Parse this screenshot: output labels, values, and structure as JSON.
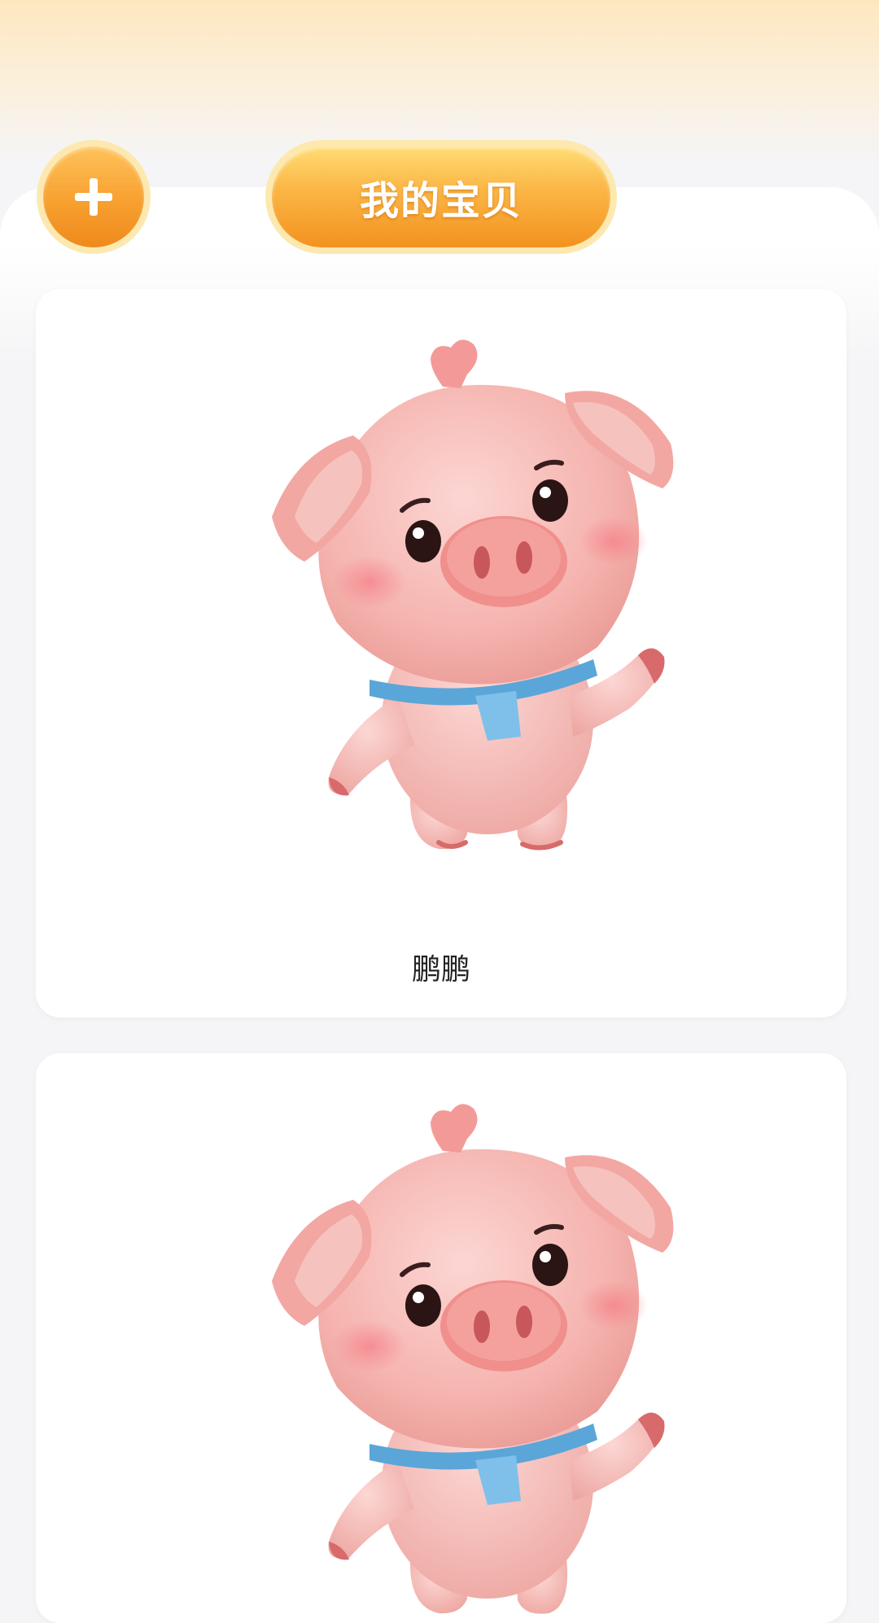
{
  "header": {
    "add_button_symbol": "+",
    "title": "我的宝贝"
  },
  "colors": {
    "accent_orange": "#f7a030",
    "pill_highlight": "#ffdd75",
    "pet_pink": "#f7b3b0",
    "collar_blue": "#5aa6d8"
  },
  "pets": [
    {
      "name": "鹏鹏",
      "avatar": "pig-avatar"
    },
    {
      "name": "",
      "avatar": "pig-avatar"
    }
  ]
}
